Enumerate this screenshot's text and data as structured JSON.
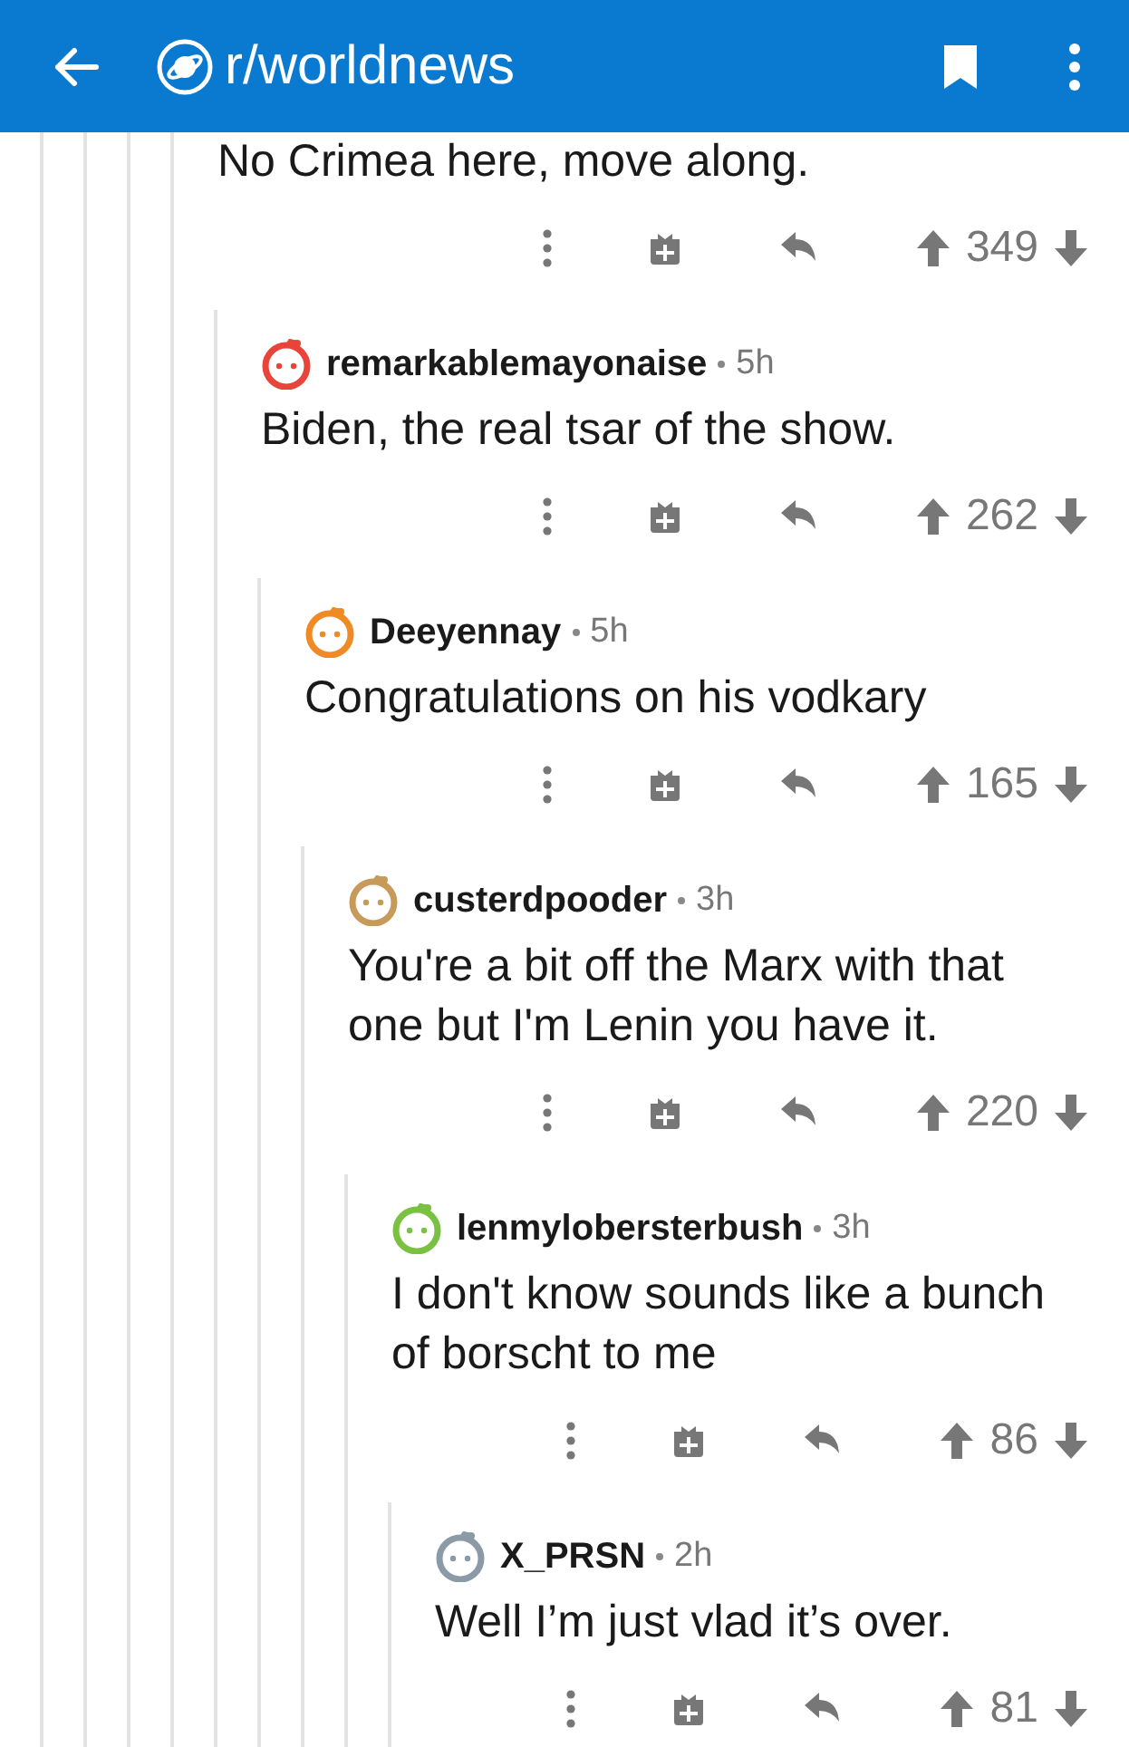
{
  "topbar": {
    "title": "r/worldnews"
  },
  "comments": [
    {
      "body": "No Crimea here, move along.",
      "score": "349",
      "children": [
        {
          "author": "remarkablemayonaise",
          "age": "5h",
          "color": "#e8443a",
          "body": "Biden, the real tsar of the show.",
          "score": "262",
          "children": [
            {
              "author": "Deeyennay",
              "age": "5h",
              "color": "#f08a24",
              "body": "Congratulations on his vodkary",
              "score": "165",
              "children": [
                {
                  "author": "custerdpooder",
                  "age": "3h",
                  "color": "#c79a5a",
                  "body": "You're a bit off the Marx with that one but I'm Lenin you have it.",
                  "score": "220",
                  "children": [
                    {
                      "author": "lenmylobersterbush",
                      "age": "3h",
                      "color": "#7ac142",
                      "body": "I don't know sounds like a bunch of borscht to me",
                      "score": "86",
                      "children": [
                        {
                          "author": "X_PRSN",
                          "age": "2h",
                          "color": "#8a9aa6",
                          "body": "Well I’m just vlad it’s over.",
                          "score": "81"
                        }
                      ]
                    }
                  ]
                }
              ]
            }
          ]
        }
      ]
    }
  ]
}
